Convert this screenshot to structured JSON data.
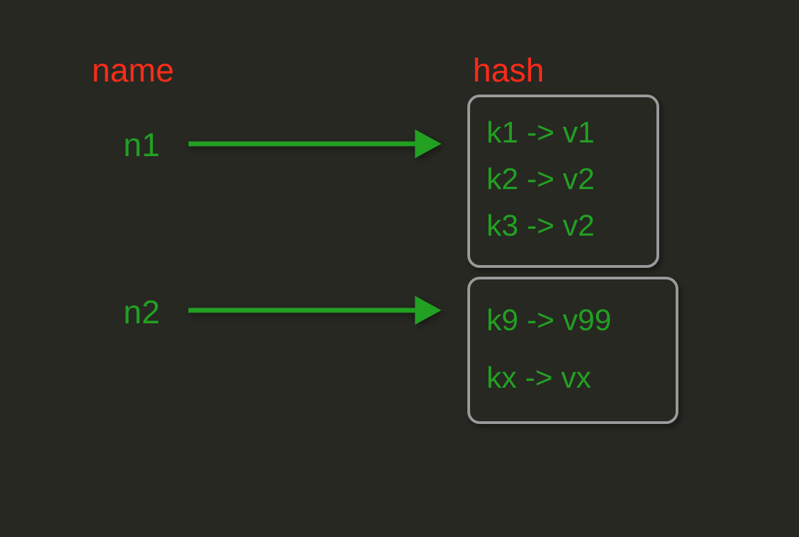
{
  "headers": {
    "name": "name",
    "hash": "hash"
  },
  "rows": [
    {
      "name": "n1",
      "entries": [
        "k1 -> v1",
        "k2 -> v2",
        "k3 -> v2"
      ]
    },
    {
      "name": "n2",
      "entries": [
        "k9 -> v99",
        "kx -> vx"
      ]
    }
  ],
  "colors": {
    "background": "#272822",
    "header": "#ff2c19",
    "text": "#22a022",
    "arrow": "#22a022",
    "boxBorder": "#9a9a9a"
  }
}
